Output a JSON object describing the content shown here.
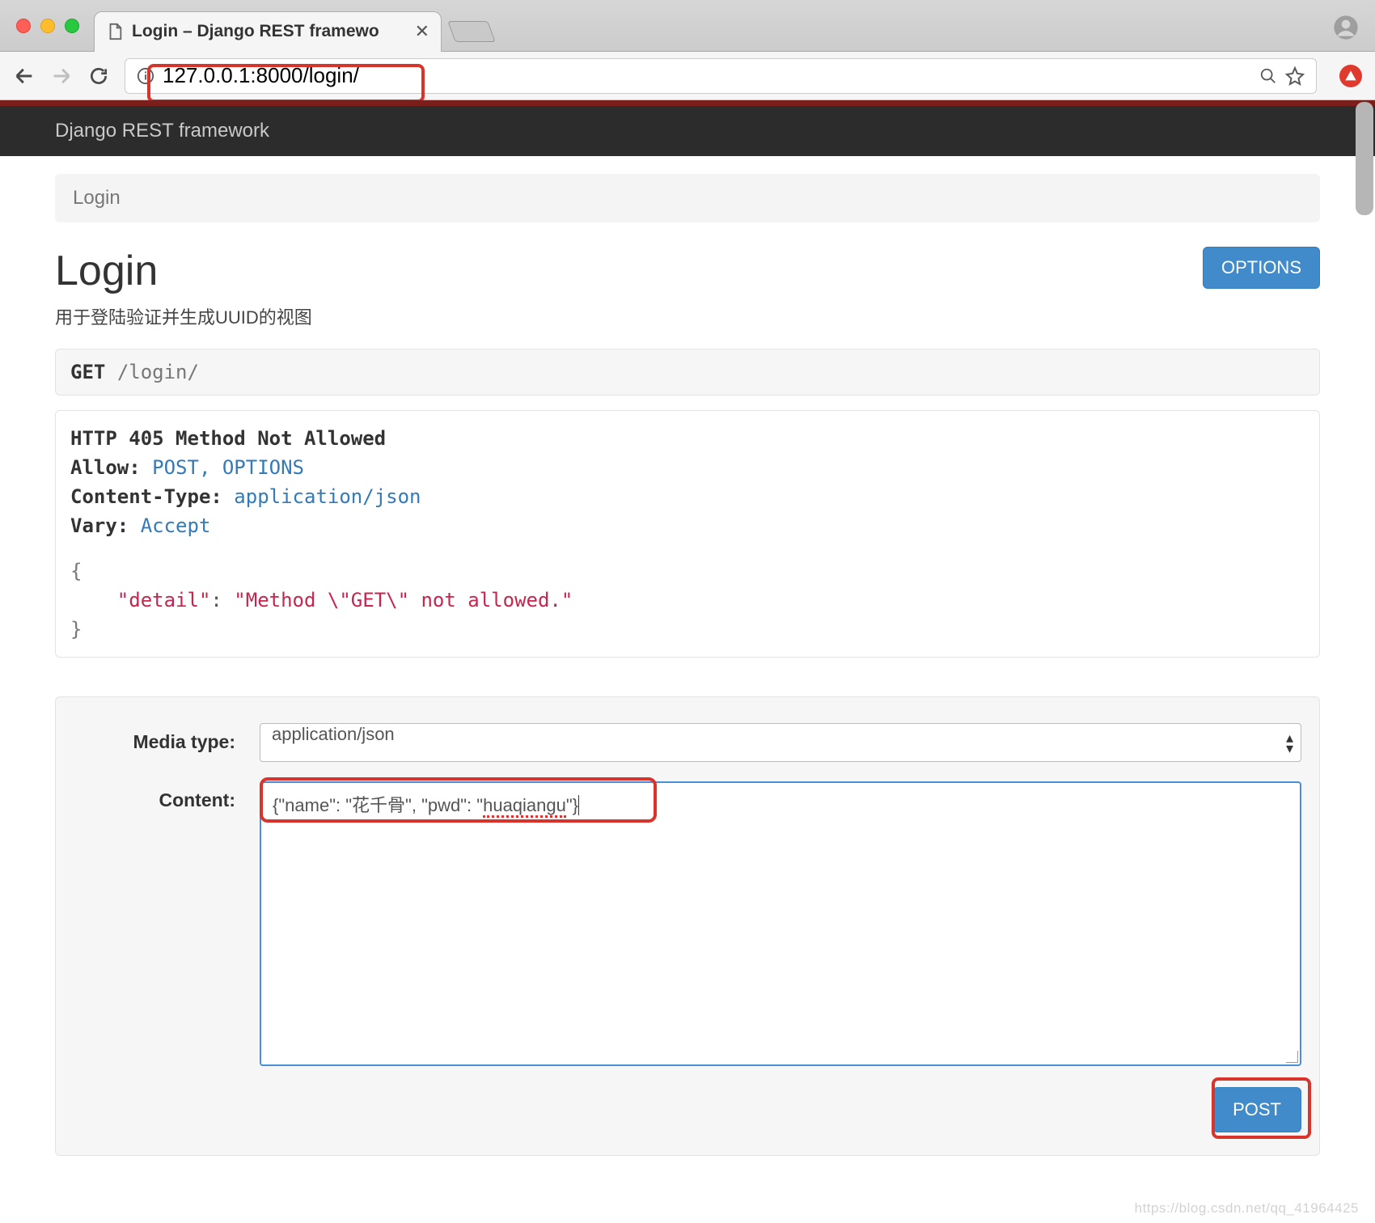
{
  "browser": {
    "tab_title": "Login – Django REST framewo",
    "url": "127.0.0.1:8000/login/"
  },
  "navbar": {
    "brand": "Django REST framework"
  },
  "breadcrumb": "Login",
  "page": {
    "title": "Login",
    "subtitle": "用于登陆验证并生成UUID的视图",
    "options_button": "OPTIONS"
  },
  "request": {
    "method": "GET",
    "path": "/login/"
  },
  "response": {
    "status": "HTTP 405 Method Not Allowed",
    "headers": {
      "Allow": "POST, OPTIONS",
      "Content-Type": "application/json",
      "Vary": "Accept"
    },
    "body_open": "{",
    "body_key": "\"detail\"",
    "body_colon": ":",
    "body_val": "\"Method \\\"GET\\\" not allowed.\"",
    "body_close": "}"
  },
  "form": {
    "media_type_label": "Media type:",
    "media_type_value": "application/json",
    "content_label": "Content:",
    "content_prefix": "{\"name\": \"花千骨\", \"pwd\": \"",
    "content_spelled": "huaqiangu",
    "content_suffix": "\"}",
    "post_button": "POST"
  },
  "watermark": "https://blog.csdn.net/qq_41964425"
}
